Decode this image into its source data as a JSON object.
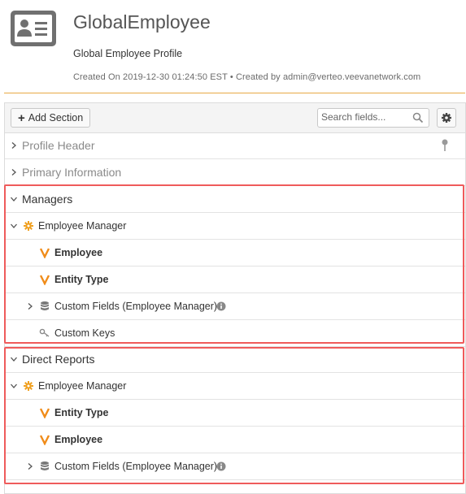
{
  "header": {
    "title": "GlobalEmployee",
    "subtitle": "Global Employee Profile",
    "meta": "Created On 2019-12-30 01:24:50 EST • Created by admin@verteo.veevanetwork.com"
  },
  "toolbar": {
    "add_section_label": "Add Section",
    "search_placeholder": "Search fields..."
  },
  "sections": {
    "profile_header": "Profile Header",
    "primary_information": "Primary Information",
    "managers": {
      "title": "Managers",
      "relationship": "Employee Manager",
      "field1": "Employee",
      "field2": "Entity Type",
      "custom_fields": "Custom Fields (Employee Manager)",
      "custom_keys": "Custom Keys"
    },
    "direct_reports": {
      "title": "Direct Reports",
      "relationship": "Employee Manager",
      "field1": "Entity Type",
      "field2": "Employee",
      "custom_fields": "Custom Fields (Employee Manager)"
    }
  },
  "colors": {
    "accent": "#e8a844",
    "highlight": "#ef5b5b",
    "veeva_v": "#f08c1a"
  }
}
